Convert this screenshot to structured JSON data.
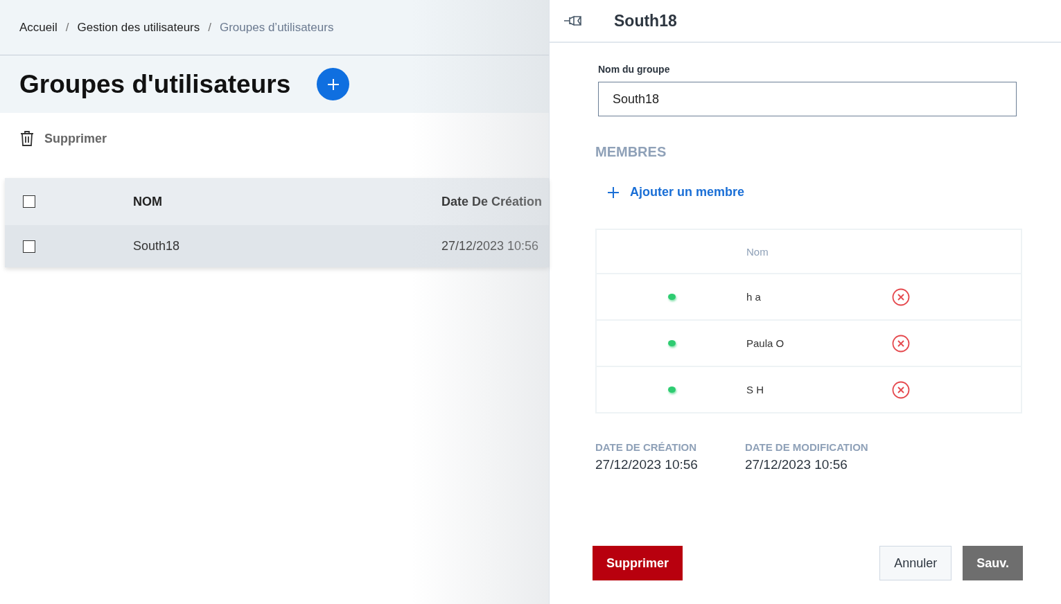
{
  "breadcrumb": [
    {
      "label": "Accueil",
      "current": false
    },
    {
      "label": "Gestion des utilisateurs",
      "current": false
    },
    {
      "label": "Groupes d’utilisateurs",
      "current": true
    }
  ],
  "breadcrumb_separator": "/",
  "page_title": "Groupes d'utilisateurs",
  "toolbar": {
    "delete_label": "Supprimer"
  },
  "table": {
    "header_checked": false,
    "columns": [
      "NOM",
      "Date De Création"
    ],
    "rows": [
      {
        "checked": false,
        "name": "South18",
        "created": "27/12/2023 10:56"
      }
    ]
  },
  "panel": {
    "title": "South18",
    "group_name_label": "Nom du groupe",
    "group_name_value": "South18",
    "members_heading": "MEMBRES",
    "add_member": "Ajouter un membre",
    "members_column": "Nom",
    "members": [
      {
        "name": "h a",
        "color": "#2ecc71"
      },
      {
        "name": "Paula O",
        "color": "#2ecc71"
      },
      {
        "name": "S H",
        "color": "#2ecc71"
      }
    ],
    "created_label": "DATE DE CRÉATION",
    "created_value": "27/12/2023 10:56",
    "modified_label": "DATE DE MODIFICATION",
    "modified_value": "27/12/2023 10:56",
    "buttons": {
      "delete": "Supprimer",
      "cancel": "Annuler",
      "save": "Sauv."
    }
  }
}
